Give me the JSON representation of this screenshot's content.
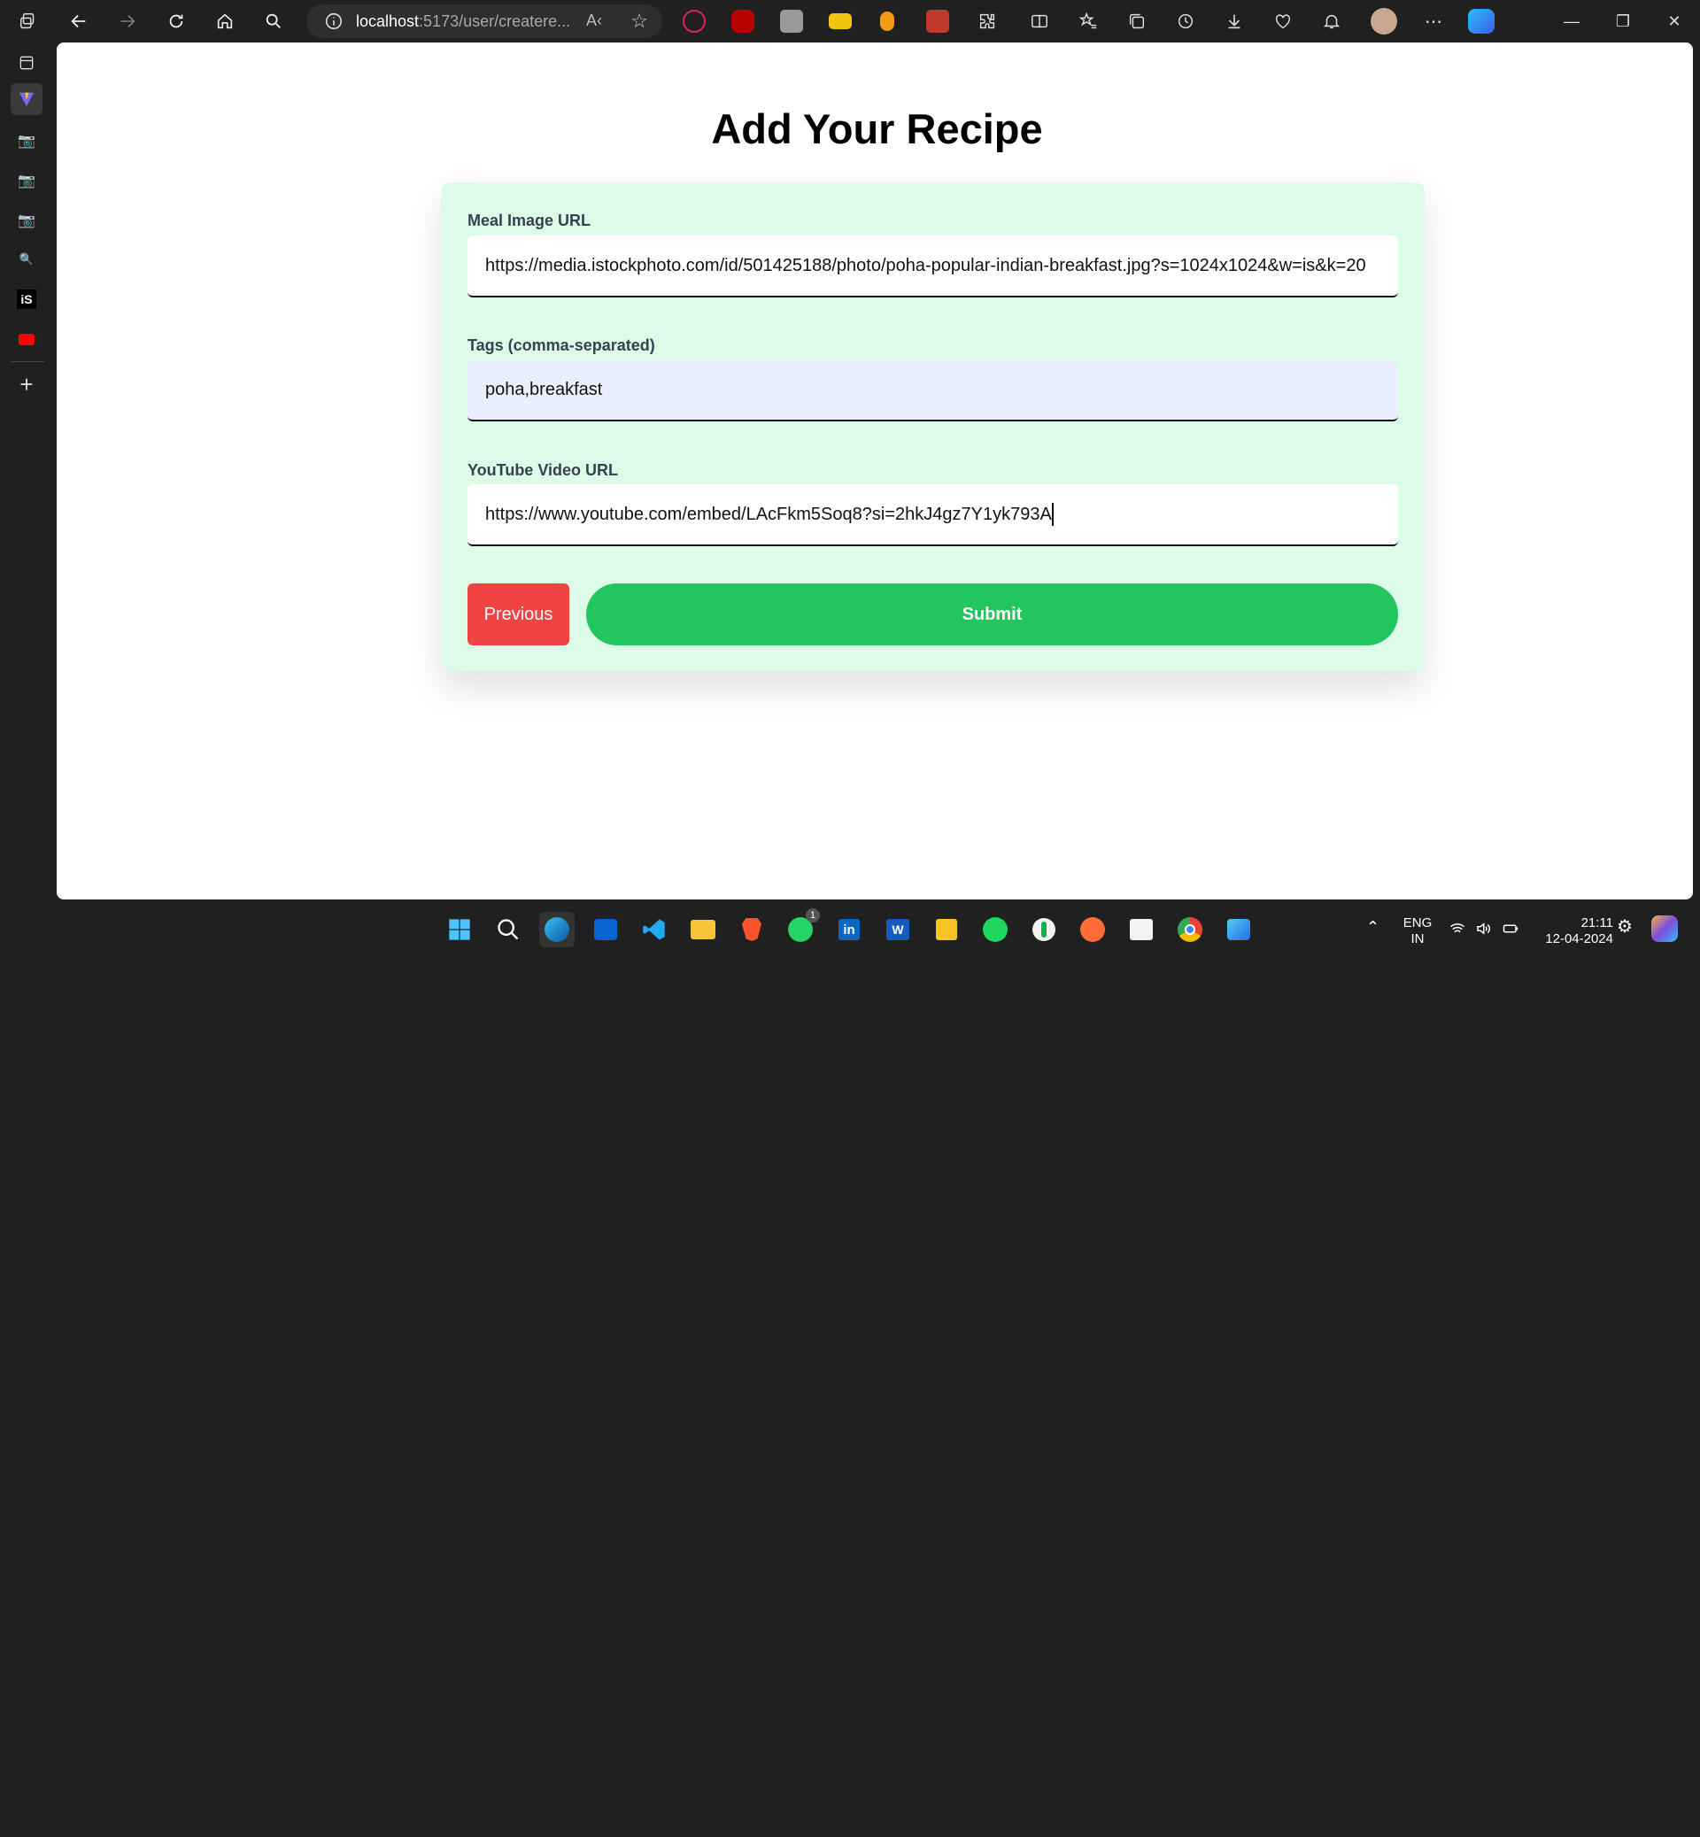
{
  "browser": {
    "url_host": "localhost",
    "url_path": ":5173/user/createre...",
    "read_aloud": "A‹",
    "favorite_icon": "star-icon"
  },
  "page": {
    "title": "Add Your Recipe"
  },
  "form": {
    "meal_image": {
      "label": "Meal Image URL",
      "value": "https://media.istockphoto.com/id/501425188/photo/poha-popular-indian-breakfast.jpg?s=1024x1024&w=is&k=20"
    },
    "tags": {
      "label": "Tags (comma-separated)",
      "value": "poha,breakfast"
    },
    "youtube": {
      "label": "YouTube Video URL",
      "value": "https://www.youtube.com/embed/LAcFkm5Soq8?si=2hkJ4gz7Y1yk793A"
    },
    "previous_label": "Previous",
    "submit_label": "Submit"
  },
  "taskbar": {
    "language": "ENG",
    "region": "IN",
    "time": "21:11",
    "date": "12-04-2024",
    "whatsapp_badge": "1"
  },
  "colors": {
    "card_bg": "#dcfce7",
    "previous_bg": "#ef4444",
    "submit_bg": "#22c55e"
  }
}
